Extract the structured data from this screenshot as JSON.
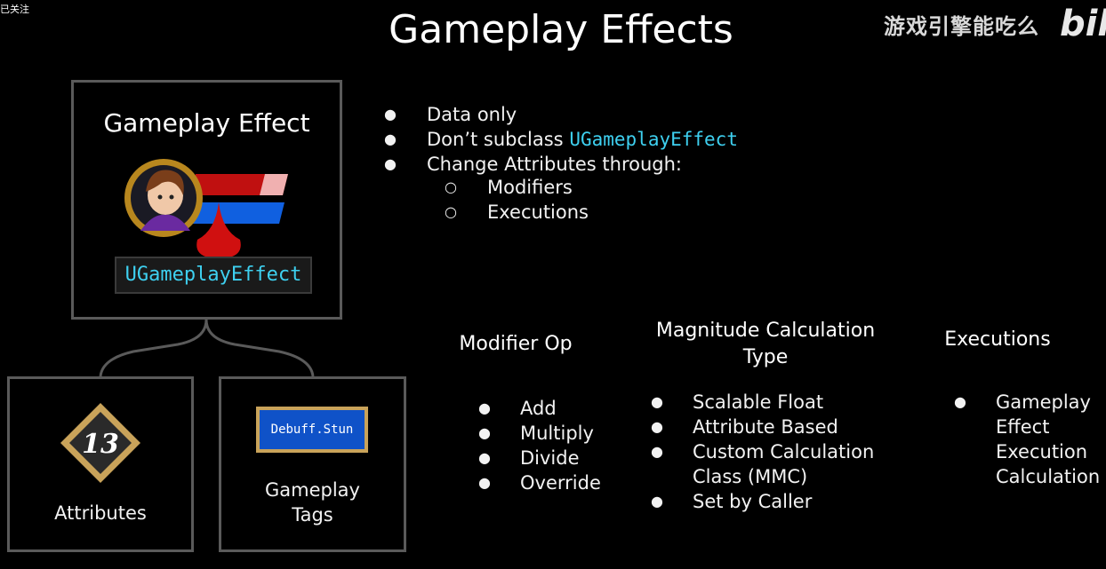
{
  "corner_tag": "已关注",
  "title": "Gameplay Effects",
  "watermark": {
    "text": "游戏引擎能吃么",
    "logo": "bili"
  },
  "gameplay_effect_box": {
    "title": "Gameplay Effect",
    "class_name": "UGameplayEffect"
  },
  "attributes_box": {
    "value": "13",
    "label": "Attributes"
  },
  "tags_box": {
    "tag": "Debuff.Stun",
    "label_line1": "Gameplay",
    "label_line2": "Tags"
  },
  "main_bullets": {
    "item1": "Data only",
    "item2_prefix": "Don’t subclass ",
    "item2_code": "UGameplayEffect",
    "item3": "Change Attributes through:",
    "sub1": "Modifiers",
    "sub2": "Executions"
  },
  "modifier_op": {
    "heading": "Modifier Op",
    "items": [
      "Add",
      "Multiply",
      "Divide",
      "Override"
    ]
  },
  "magnitude": {
    "heading_line1": "Magnitude Calculation",
    "heading_line2": "Type",
    "item1": "Scalable Float",
    "item2": "Attribute Based",
    "item3_line1": "Custom Calculation",
    "item3_line2": "Class (MMC)",
    "item4": "Set by Caller"
  },
  "executions": {
    "heading": "Executions",
    "item_line1": "Gameplay",
    "item_line2": "Effect",
    "item_line3": "Execution",
    "item_line4": "Calculation"
  },
  "colors": {
    "accent_cyan": "#3ed0f0",
    "box_border": "#5a5a5a",
    "health_red": "#d01010",
    "mana_blue": "#1060e0",
    "gold": "#c9a35a",
    "tag_blue": "#0f52c8"
  },
  "icons": [
    "character-portrait-icon",
    "health-bar-icon",
    "mana-bar-icon",
    "blood-drop-icon",
    "attribute-diamond-icon"
  ]
}
